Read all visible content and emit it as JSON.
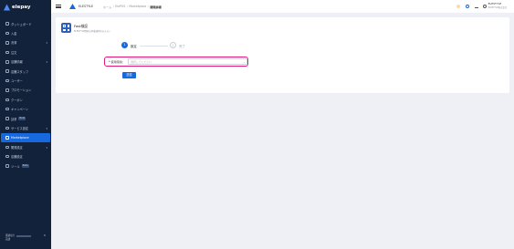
{
  "sidebar": {
    "logo": "elepay",
    "items": [
      {
        "label": "ダッシュボード",
        "icon": "dashboard-icon"
      },
      {
        "label": "入金",
        "icon": "deposit-icon"
      },
      {
        "label": "決済",
        "icon": "payment-icon",
        "chevron": "▾"
      },
      {
        "label": "注文",
        "icon": "order-icon"
      },
      {
        "label": "店舗情報",
        "icon": "store-icon",
        "chevron": "▾"
      },
      {
        "label": "店舗スタッフ",
        "icon": "staff-icon"
      },
      {
        "label": "ユーザー",
        "icon": "user-icon"
      },
      {
        "label": "プロモーション",
        "icon": "promotion-icon"
      },
      {
        "label": "クーポン",
        "icon": "coupon-icon"
      },
      {
        "label": "キャンペーン",
        "icon": "campaign-icon"
      },
      {
        "label": "請求",
        "icon": "billing-icon",
        "badge": "Beta"
      },
      {
        "label": "サービス設定",
        "icon": "service-settings-icon",
        "chevron": "▾"
      },
      {
        "label": "Marketplace",
        "icon": "marketplace-icon",
        "active": true
      },
      {
        "label": "開発設定",
        "icon": "dev-settings-icon",
        "chevron": "▾"
      },
      {
        "label": "店舗設定",
        "icon": "shop-settings-icon"
      },
      {
        "label": "ツール",
        "icon": "tool-icon",
        "badge": "Beta"
      }
    ],
    "footer": {
      "line1": "環境切り",
      "line2": "英語"
    }
  },
  "header": {
    "app_name": "ELESTYLE",
    "breadcrumb": [
      "ホーム",
      "ElePOS",
      "Marketplace",
      "開発詳細"
    ],
    "user_name": "ELESTYLE",
    "user_sub": "ELESTYLE株式会社"
  },
  "service": {
    "title": "Fast検証",
    "subtitle": "ELESTYLE開発の本番運用中のテスト"
  },
  "steps": [
    {
      "number": "1",
      "label": "設定"
    },
    {
      "number": "2",
      "label": "完了"
    }
  ],
  "form": {
    "field_label": "* 使用環境：",
    "placeholder": "選択してください",
    "submit_label": "送信"
  },
  "colors": {
    "sidebar_bg": "#13223b",
    "accent": "#1769e0",
    "highlight": "#e2177c"
  }
}
